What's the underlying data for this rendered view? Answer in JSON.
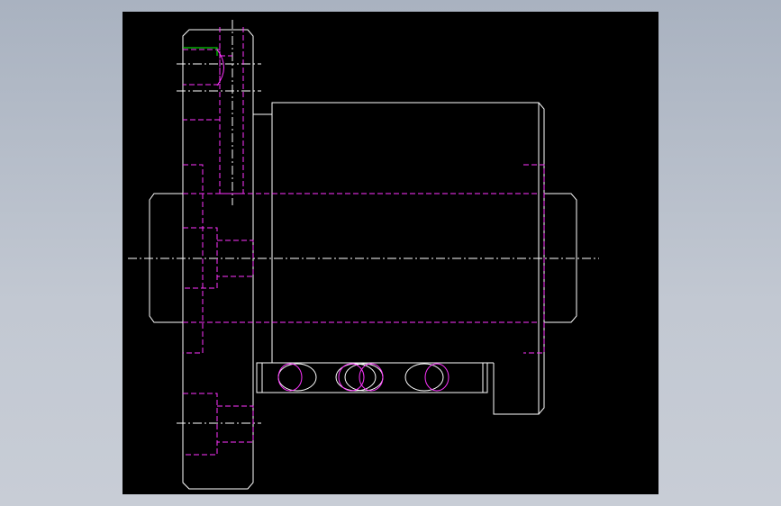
{
  "viewport": {
    "background": "#000000",
    "line_colors": {
      "visible_edges": "#ffffff",
      "hidden_edges": "#ff33ff",
      "highlight": "#00ff00"
    }
  }
}
